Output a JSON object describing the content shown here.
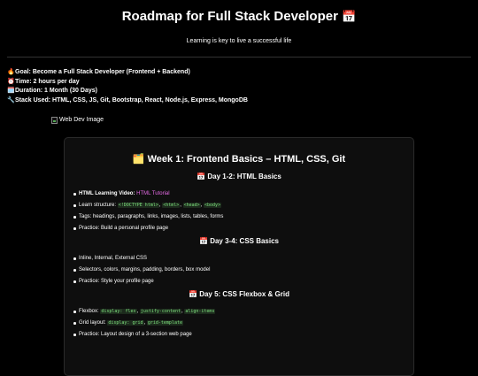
{
  "header": {
    "title": "Roadmap for Full Stack Developer",
    "title_icon": "📅",
    "subtitle": "Learning is key to live a successful life"
  },
  "meta": [
    {
      "icon": "🔥",
      "icon_name": "fire-icon",
      "text": "Goal: Become a Full Stack Developer (Frontend + Backend)"
    },
    {
      "icon": "⏰",
      "icon_name": "alarm-clock-icon",
      "text": "Time: 2 hours per day"
    },
    {
      "icon": "🗓️",
      "icon_name": "calendar-icon",
      "text": "Duration: 1 Month (30 Days)"
    },
    {
      "icon": "🔧",
      "icon_name": "wrench-icon",
      "text": "Stack Used: HTML, CSS, JS, Git, Bootstrap, React, Node.js, Express, MongoDB"
    }
  ],
  "image_alt": "Web Dev Image",
  "week": {
    "icon": "🗂️",
    "title": "Week 1: Frontend Basics – HTML, CSS, Git",
    "days": [
      {
        "icon": "📅",
        "title": "Day 1-2: HTML Basics",
        "video_label": "HTML Learning Video:",
        "video_link": "HTML Tutorial",
        "structure_label": "Learn structure:",
        "structure_codes": [
          "<!DOCTYPE html>",
          "<html>",
          "<head>",
          "<body>"
        ],
        "tags": "Tags: headings, paragraphs, links, images, lists, tables, forms",
        "practice": "Practice: Build a personal profile page"
      },
      {
        "icon": "📅",
        "title": "Day 3-4: CSS Basics",
        "items": [
          "Inline, Internal, External CSS",
          "Selectors, colors, margins, padding, borders, box model",
          "Practice: Style your profile page"
        ]
      },
      {
        "icon": "📅",
        "title": "Day 5: CSS Flexbox & Grid",
        "flexbox_label": "Flexbox:",
        "flexbox_codes": [
          "display: flex",
          "justify-content",
          "align-items"
        ],
        "grid_label": "Grid layout:",
        "grid_codes": [
          "display: grid",
          "grid-template"
        ],
        "practice": "Practice: Layout design of a 3-section web page"
      }
    ]
  }
}
